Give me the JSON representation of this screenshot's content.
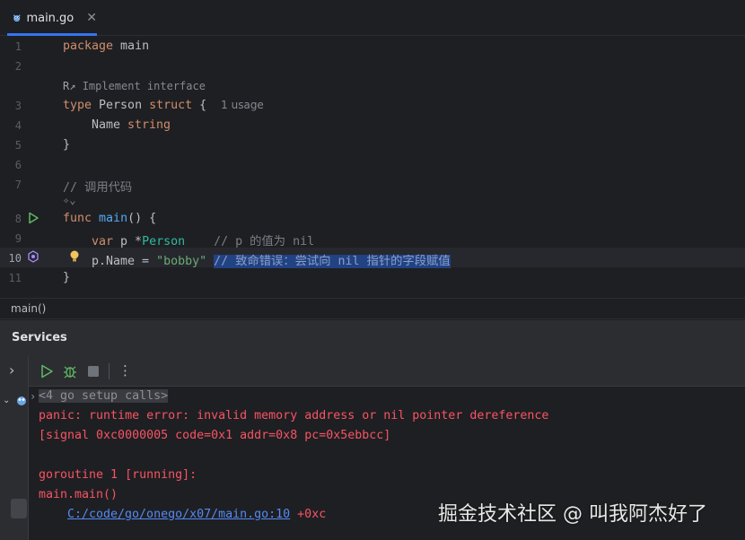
{
  "tab": {
    "label": "main.go",
    "close": "✕"
  },
  "gutter": [
    "1",
    "2",
    "3",
    "4",
    "5",
    "6",
    "7",
    "8",
    "9",
    "10",
    "11"
  ],
  "editor": {
    "implement_hint": "Implement interface",
    "line1": {
      "kw": "package",
      "rest": " main"
    },
    "line3": {
      "kw": "type",
      "name": " Person ",
      "kw2": "struct",
      "brace": " {",
      "usage": "1 usage"
    },
    "line4": {
      "field": "Name ",
      "type": "string"
    },
    "line5": "}",
    "line7": "// 调用代码",
    "line8": {
      "kw": "func",
      "name": "main",
      "rest": "() {"
    },
    "line9": {
      "kw": "var",
      "rest": " p *",
      "type": "Person",
      "comment": "// p 的值为 nil"
    },
    "line10": {
      "code": "p.Name = ",
      "str": "\"bobby\"",
      "comment": "// 致命错误：尝试向 nil 指针的字段赋值"
    },
    "line11": "}"
  },
  "breadcrumb": "main()",
  "services": {
    "title": "Services",
    "expand": "›",
    "more": "⋮"
  },
  "console": {
    "setup": "<4 go setup calls>",
    "panic": "panic: runtime error: invalid memory address or nil pointer dereference",
    "signal": "[signal 0xc0000005 code=0x1 addr=0x8 pc=0x5ebbcc]",
    "goroutine": "goroutine 1 [running]:",
    "main_main": "main.main()",
    "path": "C:/code/go/onego/x07/main.go:10",
    "offset": " +0xc"
  },
  "watermark": "掘金技术社区 @ 叫我阿杰好了",
  "colors": {
    "accent": "#3574f0",
    "error": "#f75464",
    "link": "#548af7"
  }
}
